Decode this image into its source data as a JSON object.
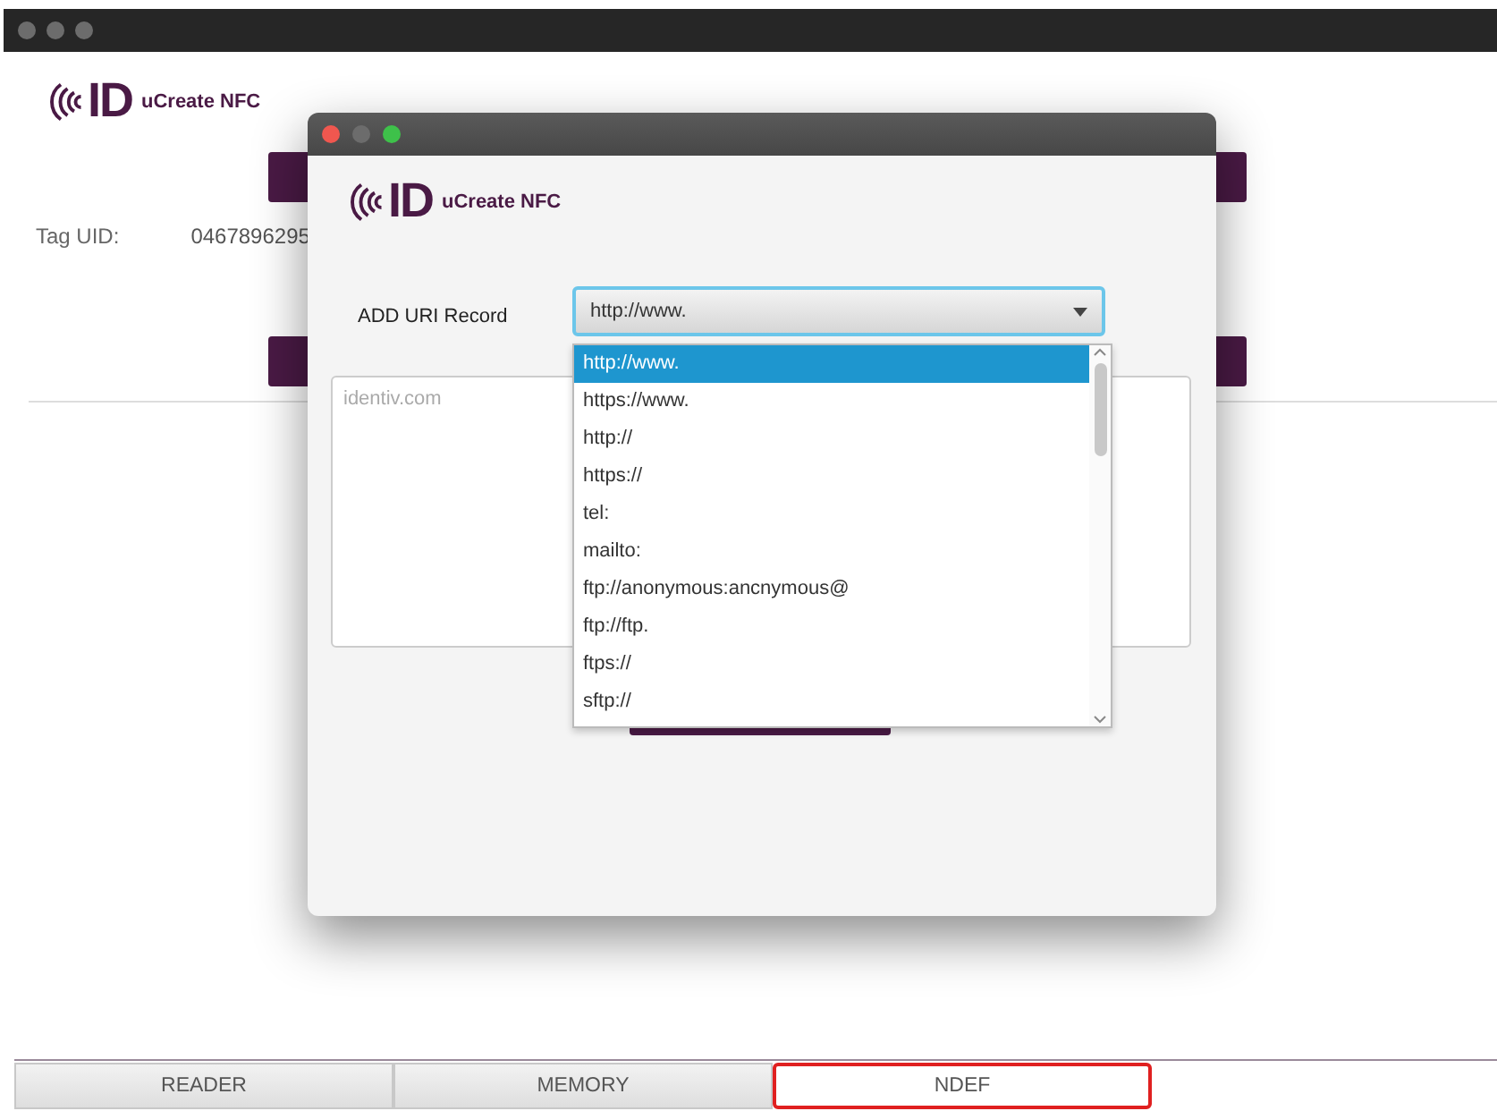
{
  "app": {
    "logo_mark": "ID",
    "logo_text": "uCreate NFC",
    "tag_uid_label": "Tag UID:",
    "tag_uid_value": "0467896295"
  },
  "dialog": {
    "logo_mark": "ID",
    "logo_text": "uCreate NFC",
    "record_label": "ADD URI Record",
    "combo_value": "http://www.",
    "textarea_placeholder": "identiv.com",
    "options": [
      {
        "label": "http://www.",
        "selected": true
      },
      {
        "label": "https://www.",
        "selected": false
      },
      {
        "label": "http://",
        "selected": false
      },
      {
        "label": "https://",
        "selected": false
      },
      {
        "label": "tel:",
        "selected": false
      },
      {
        "label": "mailto:",
        "selected": false
      },
      {
        "label": "ftp://anonymous:ancnymous@",
        "selected": false
      },
      {
        "label": "ftp://ftp.",
        "selected": false
      },
      {
        "label": "ftps://",
        "selected": false
      },
      {
        "label": "sftp://",
        "selected": false
      }
    ]
  },
  "tabs": [
    {
      "label": "READER",
      "selected": false
    },
    {
      "label": "MEMORY",
      "selected": false
    },
    {
      "label": "NDEF",
      "selected": true
    }
  ]
}
